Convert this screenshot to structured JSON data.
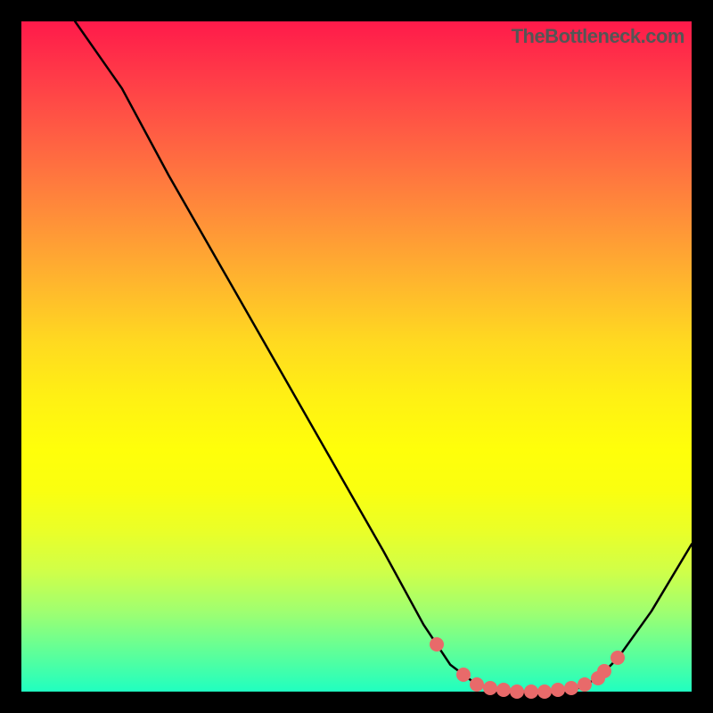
{
  "watermark": "TheBottleneck.com",
  "chart_data": {
    "type": "line",
    "title": "",
    "xlabel": "",
    "ylabel": "",
    "x_range": [
      0,
      100
    ],
    "y_range": [
      0,
      100
    ],
    "curve": [
      {
        "x": 8,
        "y": 100
      },
      {
        "x": 15,
        "y": 90
      },
      {
        "x": 22,
        "y": 77
      },
      {
        "x": 30,
        "y": 63
      },
      {
        "x": 38,
        "y": 49
      },
      {
        "x": 46,
        "y": 35
      },
      {
        "x": 54,
        "y": 21
      },
      {
        "x": 60,
        "y": 10
      },
      {
        "x": 64,
        "y": 4
      },
      {
        "x": 68,
        "y": 1
      },
      {
        "x": 73,
        "y": 0
      },
      {
        "x": 78,
        "y": 0
      },
      {
        "x": 83,
        "y": 0.5
      },
      {
        "x": 86,
        "y": 2
      },
      {
        "x": 89,
        "y": 5
      },
      {
        "x": 94,
        "y": 12
      },
      {
        "x": 100,
        "y": 22
      }
    ],
    "markers": [
      {
        "x": 62,
        "y": 7
      },
      {
        "x": 66,
        "y": 2.5
      },
      {
        "x": 68,
        "y": 1
      },
      {
        "x": 70,
        "y": 0.5
      },
      {
        "x": 72,
        "y": 0.2
      },
      {
        "x": 74,
        "y": 0
      },
      {
        "x": 76,
        "y": 0
      },
      {
        "x": 78,
        "y": 0
      },
      {
        "x": 80,
        "y": 0.2
      },
      {
        "x": 82,
        "y": 0.5
      },
      {
        "x": 84,
        "y": 1
      },
      {
        "x": 86,
        "y": 2
      },
      {
        "x": 87,
        "y": 3
      },
      {
        "x": 89,
        "y": 5
      }
    ],
    "gradient_note": "background is red at top transitioning through orange and yellow to green at bottom"
  }
}
